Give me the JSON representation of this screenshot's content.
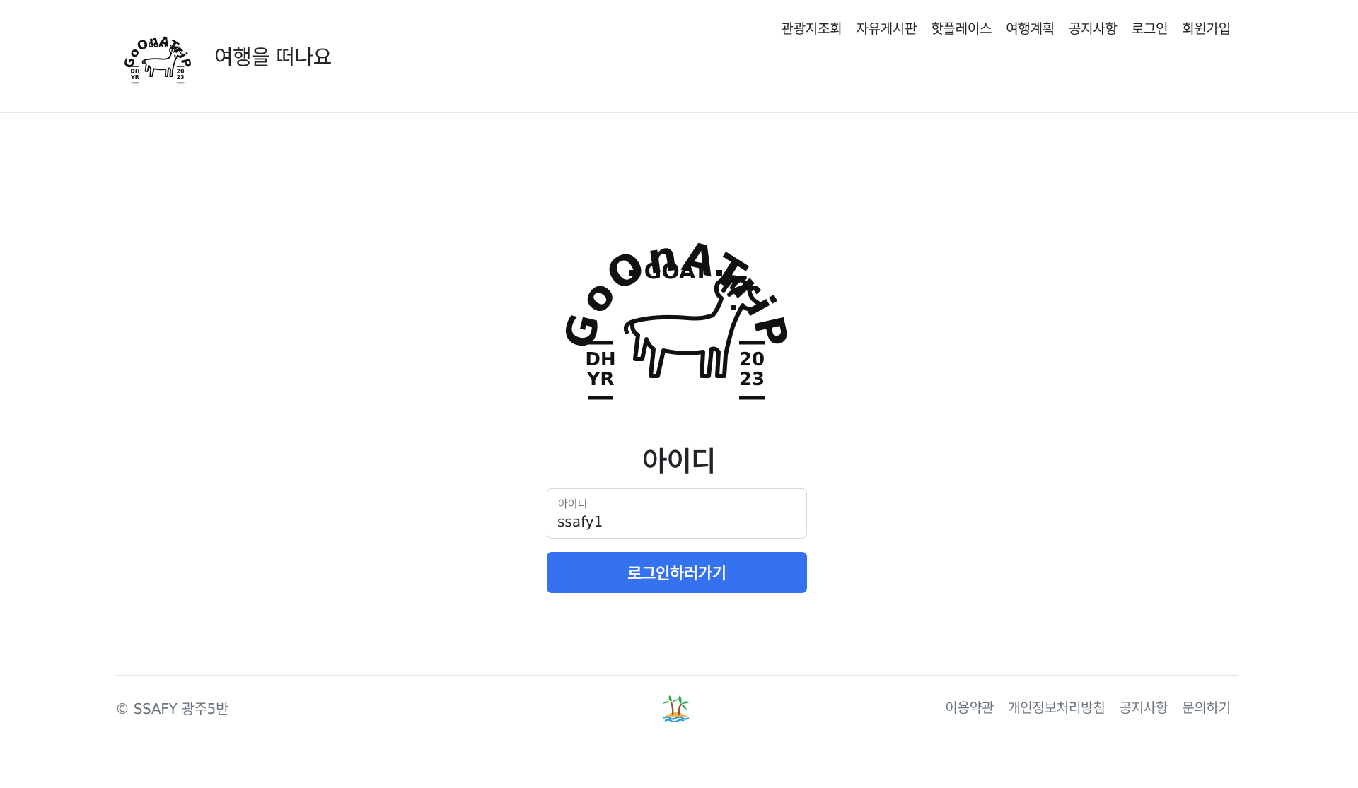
{
  "header": {
    "brand_text": "여행을 떠나요",
    "logo_lettering": "GoOnATriP · GOAT · DH YR · 20 23",
    "nav": [
      {
        "label": "관광지조회",
        "icon": "none"
      },
      {
        "label": "자유게시판",
        "icon": "none"
      },
      {
        "label": "핫플레이스",
        "icon": "none"
      },
      {
        "label": "여행계획",
        "icon": "none"
      },
      {
        "label": "공지사항",
        "icon": "none"
      },
      {
        "label": "로그인",
        "icon": "none"
      },
      {
        "label": "회원가입",
        "icon": "none"
      }
    ]
  },
  "main": {
    "logo_lettering": "GoOnATriP · GOAT · DH YR · 20 23",
    "title": "아이디",
    "id_field": {
      "label": "아이디",
      "value": "ssafy1",
      "placeholder": "아이디"
    },
    "submit_label": "로그인하러가기"
  },
  "footer": {
    "copyright": "© SSAFY 광주5반",
    "center_icon": "island-palm-icon",
    "links": [
      "이용약관",
      "개인정보처리방침",
      "공지사항",
      "문의하기"
    ]
  },
  "colors": {
    "primary": "#3472f0",
    "text": "#212529",
    "muted": "#6c757d",
    "border": "#e6e6e6"
  }
}
